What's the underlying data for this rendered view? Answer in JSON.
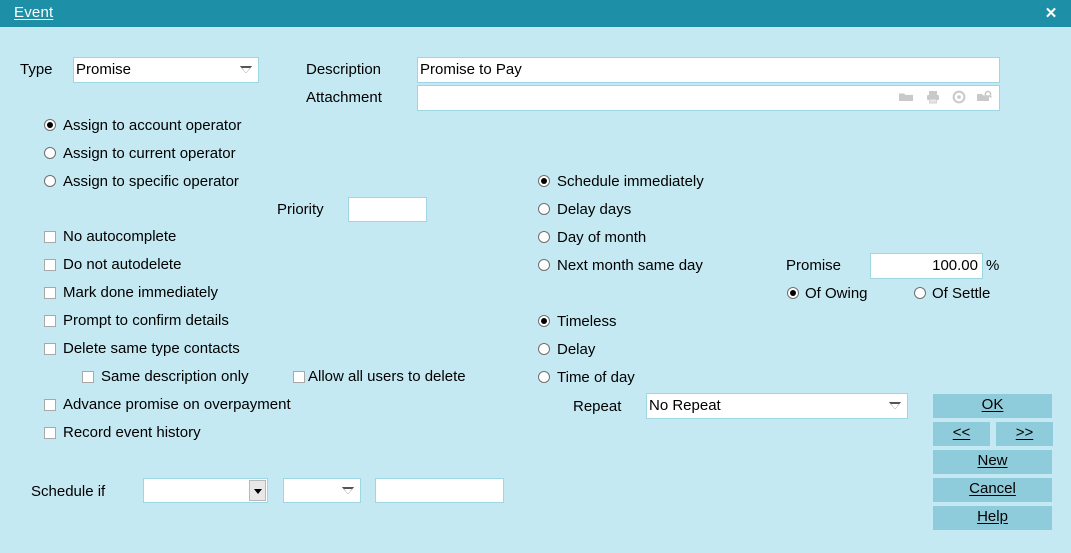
{
  "window": {
    "title": "Event",
    "close_label": "✕",
    "bg_color": "#c5e9f2",
    "titlebar_color": "#1d8fa6",
    "button_color": "#8fccdb",
    "field_border_color": "#9fd6e6"
  },
  "header": {
    "type_label": "Type",
    "type_value": "Promise",
    "description_label": "Description",
    "description_value": "Promise to Pay",
    "attachment_label": "Attachment",
    "attachment_value": "",
    "attachment_icons": [
      "folder-open-icon",
      "print-icon",
      "delete-circle-icon",
      "folder-search-icon"
    ]
  },
  "assign_group": {
    "options": [
      {
        "label": "Assign to account operator",
        "selected": true
      },
      {
        "label": "Assign to current operator",
        "selected": false
      },
      {
        "label": "Assign to specific operator",
        "selected": false
      }
    ]
  },
  "priority": {
    "label": "Priority",
    "value": ""
  },
  "options": [
    {
      "label": "No autocomplete",
      "checked": false
    },
    {
      "label": "Do not autodelete",
      "checked": false
    },
    {
      "label": "Mark done immediately",
      "checked": false
    },
    {
      "label": "Prompt to confirm details",
      "checked": false
    },
    {
      "label": "Delete same type contacts",
      "checked": false
    },
    {
      "label": "Same description only",
      "checked": false
    },
    {
      "label": "Allow all users to delete",
      "checked": false
    },
    {
      "label": "Advance promise on overpayment",
      "checked": false
    },
    {
      "label": "Record event history",
      "checked": false
    }
  ],
  "schedule_group": {
    "options": [
      {
        "label": "Schedule immediately",
        "selected": true
      },
      {
        "label": "Delay days",
        "selected": false
      },
      {
        "label": "Day of month",
        "selected": false
      },
      {
        "label": "Next month same day",
        "selected": false
      }
    ]
  },
  "promise": {
    "label": "Promise",
    "value": "100.00",
    "unit": "%",
    "basis": [
      {
        "label": "Of Owing",
        "selected": true
      },
      {
        "label": "Of Settle",
        "selected": false
      }
    ]
  },
  "timing_group": {
    "options": [
      {
        "label": "Timeless",
        "selected": true
      },
      {
        "label": "Delay",
        "selected": false
      },
      {
        "label": "Time of day",
        "selected": false
      }
    ]
  },
  "repeat": {
    "label": "Repeat",
    "value": "No Repeat"
  },
  "schedule_if": {
    "label": "Schedule if",
    "field1_value": "",
    "field2_value": "",
    "field3_value": ""
  },
  "buttons": {
    "ok": {
      "accel": "O",
      "rest": "K"
    },
    "prev": "<<",
    "next": ">>",
    "new": {
      "accel": "N",
      "rest": "ew"
    },
    "cancel": {
      "accel": "C",
      "rest": "ancel"
    },
    "help": {
      "accel": "H",
      "rest": "elp"
    }
  }
}
